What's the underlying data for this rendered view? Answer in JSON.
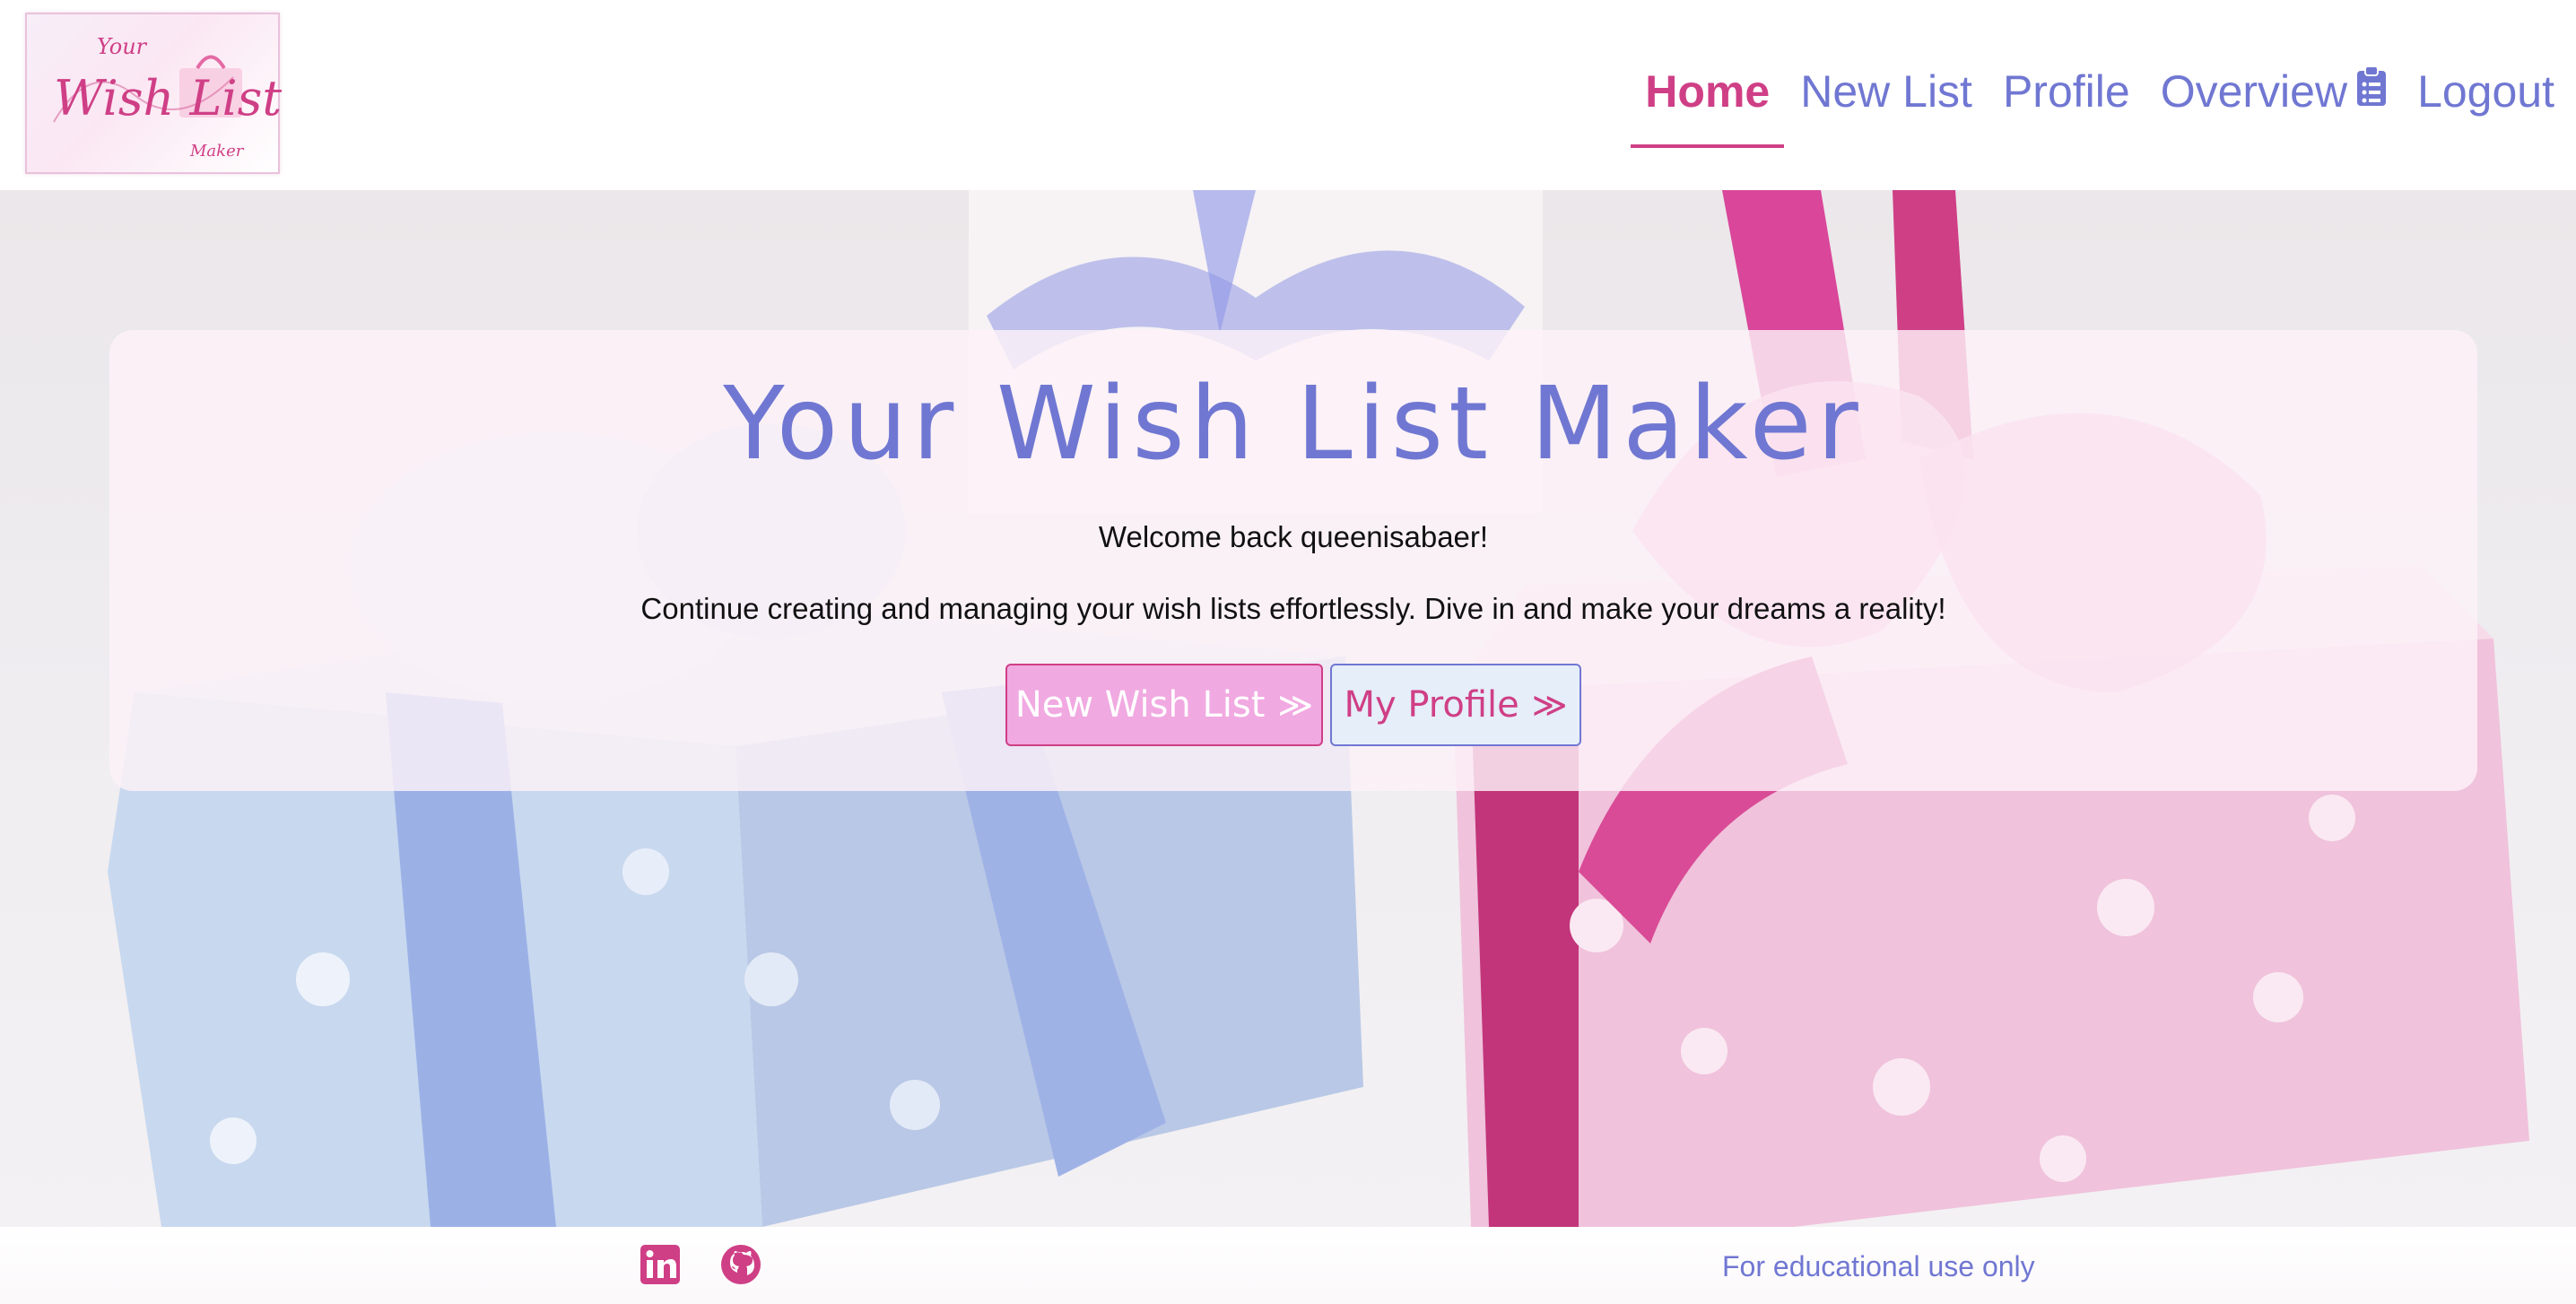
{
  "header": {
    "logo": {
      "line1": "Your",
      "line2": "Wish List",
      "line3": "Maker"
    },
    "nav": {
      "home": "Home",
      "new_list": "New List",
      "profile": "Profile",
      "overview": "Overview",
      "overview_icon": "clipboard-list-icon",
      "logout": "Logout"
    }
  },
  "hero": {
    "title": "Your Wish List Maker",
    "welcome": "Welcome back queenisabaer!",
    "tagline": "Continue creating and managing your wish lists effortlessly. Dive in and make your dreams a reality!",
    "buttons": {
      "new_wish_list": "New Wish List",
      "my_profile": "My Profile",
      "chevron": "≫"
    },
    "background": "gift-boxes-photo"
  },
  "footer": {
    "social": [
      "linkedin-icon",
      "github-icon"
    ],
    "note": "For educational use only"
  },
  "colors": {
    "primary_blue": "#7077d2",
    "accent_pink": "#cf3f86",
    "button_pink": "#f1a9e1",
    "button_light_blue": "#e6eef9"
  }
}
